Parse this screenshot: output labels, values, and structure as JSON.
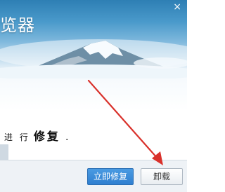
{
  "window": {
    "title_fragment": "览器",
    "close_glyph": "×"
  },
  "message": {
    "prefix": "进 行",
    "emphasis": "修复",
    "suffix": "."
  },
  "buttons": {
    "repair_label": "立即修复",
    "uninstall_label": "卸载"
  },
  "colors": {
    "sky_top": "#2e7fb4",
    "primary_button": "#3a8ad8",
    "annotation_arrow": "#d9312b"
  },
  "icons": [
    "close-icon",
    "mountain-illustration"
  ]
}
